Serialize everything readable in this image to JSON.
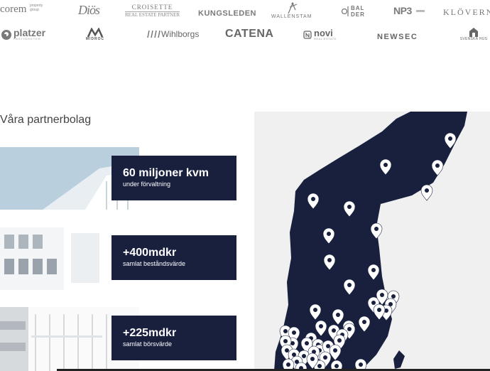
{
  "partner_logos": {
    "row1": [
      "corem",
      "property group",
      "Diös",
      "CROISETTE",
      "REAL ESTATE PARTNER",
      "KUNGSLEDEN",
      "WALLENSTAM",
      "BAL",
      "DER",
      "NP3",
      "KLÖVERN"
    ],
    "row2": [
      "platzer",
      "FASTIGHETER",
      "MIDROC",
      "Wihlborgs",
      "CATENA",
      "novi",
      "REAL ESTATE",
      "NEWSEC",
      "SVENSKA HUS"
    ]
  },
  "section": {
    "heading": "Våra partnerbolag"
  },
  "stats": [
    {
      "value": "60 miljoner kvm",
      "caption": "under förvaltning"
    },
    {
      "value": "+400mdkr",
      "caption": "samlat beståndsvärde"
    },
    {
      "value": "+225mdkr",
      "caption": "samlat börsvärde"
    }
  ],
  "map": {
    "land_color": "#18203e",
    "background_color": "#f0f0f0",
    "marker_color": "#ffffff",
    "marker_icon": "map-pin-icon",
    "marker_count": 49
  }
}
